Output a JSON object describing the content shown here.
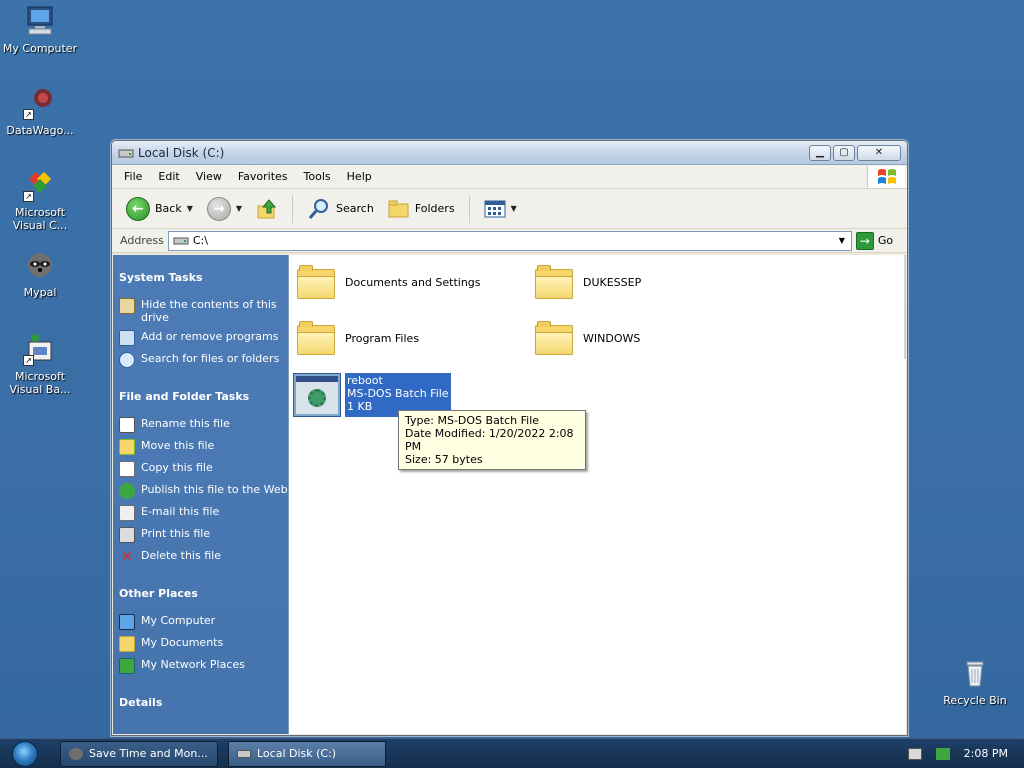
{
  "desktop": {
    "icons": [
      {
        "label": "My Computer"
      },
      {
        "label": "DataWago..."
      },
      {
        "label": "Microsoft Visual C..."
      },
      {
        "label": "Mypal"
      },
      {
        "label": "Microsoft Visual Ba..."
      },
      {
        "label": "Recycle Bin"
      }
    ]
  },
  "window": {
    "title": "Local Disk (C:)",
    "menu": [
      "File",
      "Edit",
      "View",
      "Favorites",
      "Tools",
      "Help"
    ],
    "toolbar": {
      "back": "Back",
      "search": "Search",
      "folders": "Folders"
    },
    "address": {
      "label": "Address",
      "value": "C:\\",
      "go": "Go"
    },
    "taskpane": {
      "system_tasks": {
        "title": "System Tasks",
        "items": [
          "Hide the contents of this drive",
          "Add or remove programs",
          "Search for files or folders"
        ]
      },
      "file_tasks": {
        "title": "File and Folder Tasks",
        "items": [
          "Rename this file",
          "Move this file",
          "Copy this file",
          "Publish this file to the Web",
          "E-mail this file",
          "Print this file",
          "Delete this file"
        ]
      },
      "other_places": {
        "title": "Other Places",
        "items": [
          "My Computer",
          "My Documents",
          "My Network Places"
        ]
      },
      "details": {
        "title": "Details"
      }
    },
    "files": {
      "folders": [
        "Documents and Settings",
        "DUKESSEP",
        "Program Files",
        "WINDOWS"
      ],
      "selected": {
        "name": "reboot",
        "type": "MS-DOS Batch File",
        "size": "1 KB"
      },
      "tooltip": {
        "type": "Type: MS-DOS Batch File",
        "modified": "Date Modified: 1/20/2022 2:08 PM",
        "size": "Size: 57 bytes"
      }
    }
  },
  "taskbar": {
    "tasks": [
      "Save Time and Mon...",
      "Local Disk (C:)"
    ],
    "clock": "2:08 PM"
  }
}
